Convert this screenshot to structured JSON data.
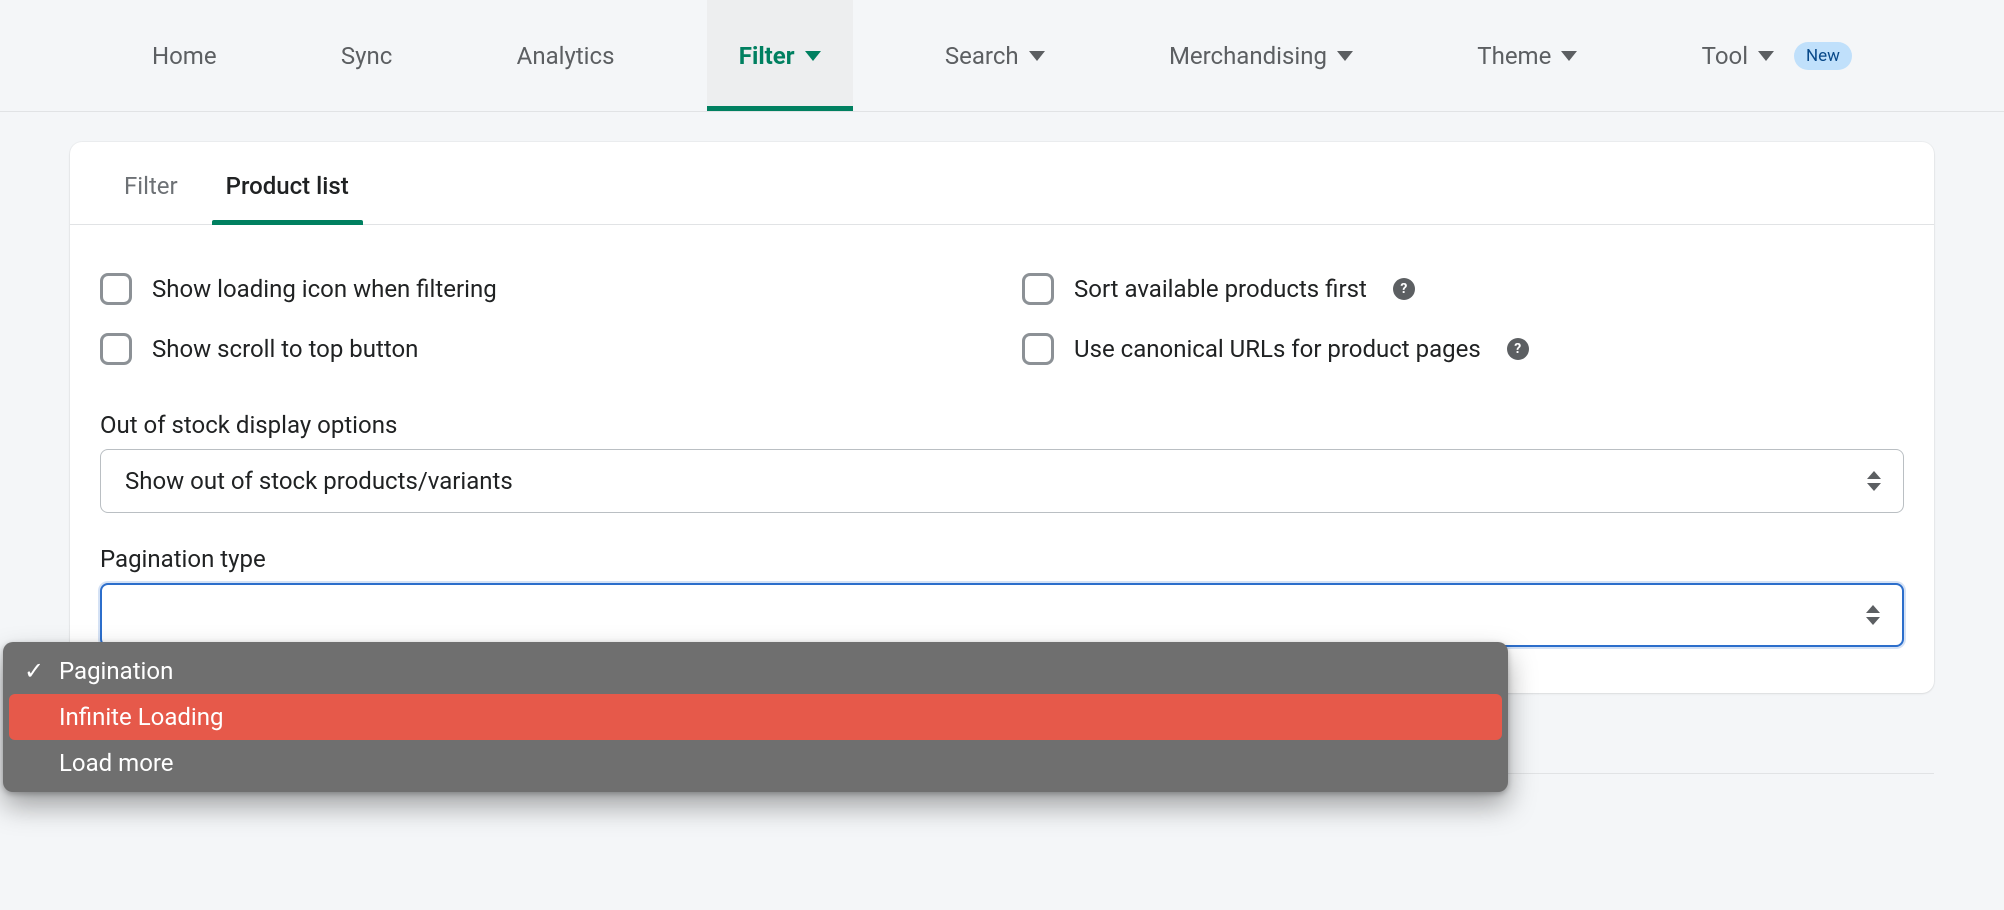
{
  "nav": {
    "items": [
      {
        "label": "Home",
        "dropdown": false
      },
      {
        "label": "Sync",
        "dropdown": false
      },
      {
        "label": "Analytics",
        "dropdown": false
      },
      {
        "label": "Filter",
        "dropdown": true,
        "active": true
      },
      {
        "label": "Search",
        "dropdown": true
      },
      {
        "label": "Merchandising",
        "dropdown": true
      },
      {
        "label": "Theme",
        "dropdown": true
      },
      {
        "label": "Tool",
        "dropdown": true,
        "badge": "New"
      }
    ]
  },
  "subtabs": {
    "items": [
      {
        "label": "Filter"
      },
      {
        "label": "Product list",
        "active": true
      }
    ]
  },
  "checks": {
    "left": [
      "Show loading icon when filtering",
      "Show scroll to top button"
    ],
    "right": [
      "Sort available products first",
      "Use canonical URLs for product pages"
    ]
  },
  "out_of_stock": {
    "label": "Out of stock display options",
    "value": "Show out of stock products/variants"
  },
  "pagination": {
    "label": "Pagination type",
    "options": [
      {
        "label": "Pagination",
        "selected": true
      },
      {
        "label": "Infinite Loading",
        "hovered": true
      },
      {
        "label": "Load more"
      }
    ]
  },
  "help_char": "?"
}
